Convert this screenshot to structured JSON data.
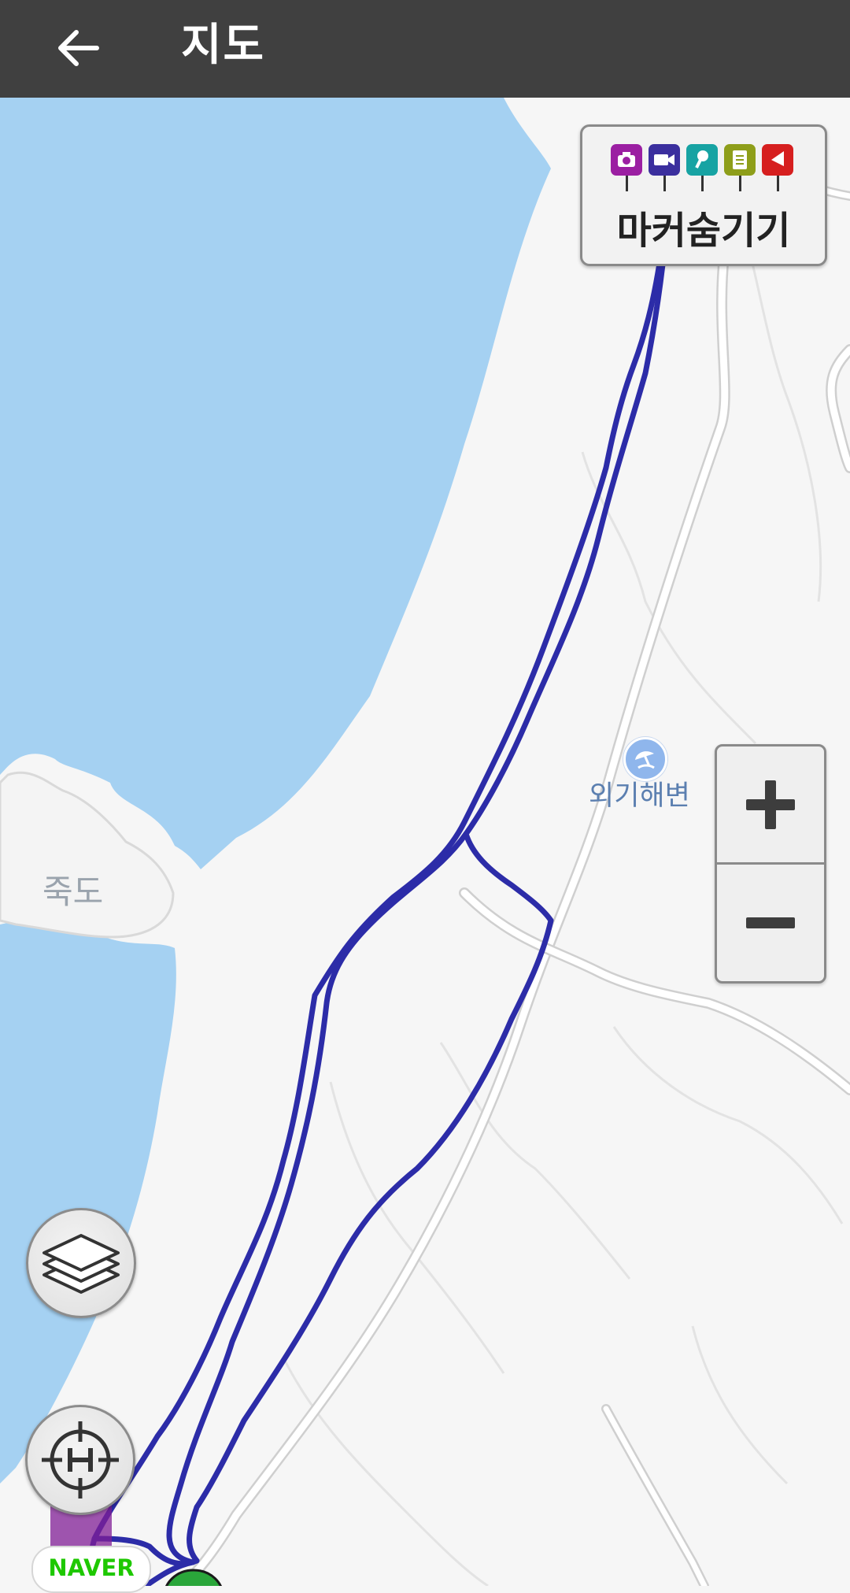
{
  "header": {
    "title": "지도",
    "back_icon": "arrow-left-icon"
  },
  "map": {
    "labels": {
      "beach": "외기해변",
      "island": "죽도"
    },
    "colors": {
      "water": "#a5d1f2",
      "land": "#f6f6f6",
      "track": "#2c2ca8",
      "road": "#ffffff"
    }
  },
  "marker_toggle": {
    "label": "마커숨기기",
    "icons": [
      {
        "name": "camera-icon",
        "color": "#9b1fa2"
      },
      {
        "name": "video-icon",
        "color": "#3b2f9e"
      },
      {
        "name": "microphone-icon",
        "color": "#17a3a3"
      },
      {
        "name": "memo-icon",
        "color": "#8e9e1a"
      },
      {
        "name": "flag-icon",
        "color": "#d61f1f"
      }
    ]
  },
  "zoom": {
    "in_icon": "plus-icon",
    "out_icon": "minus-icon"
  },
  "controls": {
    "layers_icon": "layers-icon",
    "home_icon": "home-location-icon"
  },
  "branding": {
    "logo": "NAVER"
  }
}
